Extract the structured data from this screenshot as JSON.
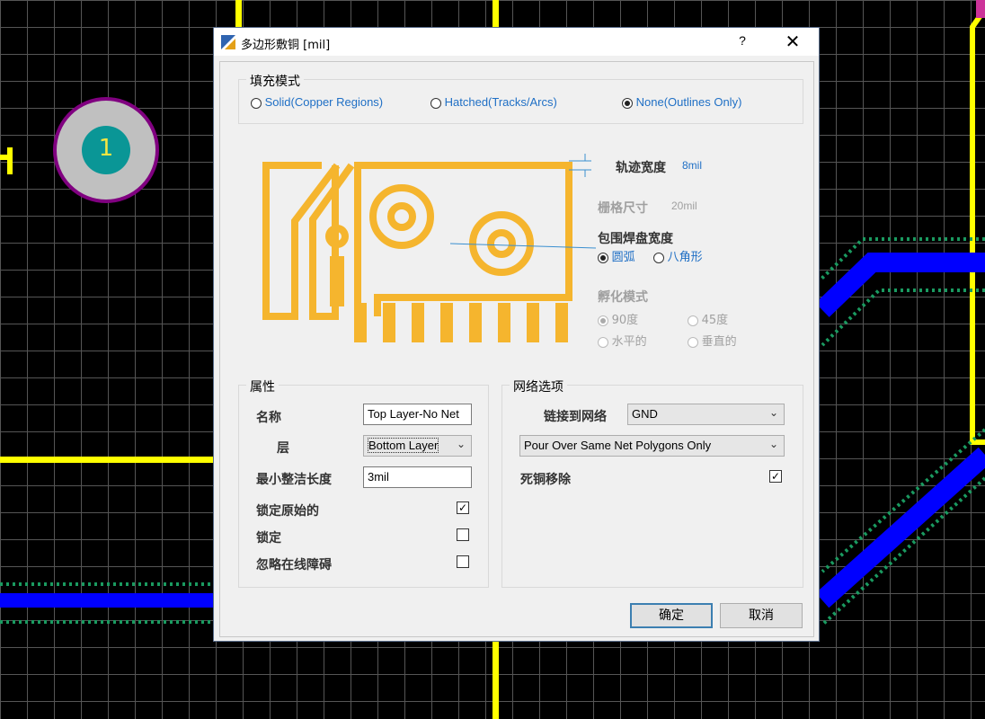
{
  "dialog": {
    "title": "多边形敷铜 [mil]",
    "help_label": "?",
    "close_label": "✕",
    "title_icon": "polygon-pour-icon"
  },
  "fill_mode": {
    "legend": "填充模式",
    "options": [
      {
        "label": "Solid(Copper Regions)",
        "selected": false
      },
      {
        "label": "Hatched(Tracks/Arcs)",
        "selected": false
      },
      {
        "label": "None(Outlines Only)",
        "selected": true
      }
    ]
  },
  "preview": {
    "track_width_label": "轨迹宽度",
    "track_width_value": "8mil",
    "grid_size_label": "栅格尺寸",
    "grid_size_value": "20mil",
    "surround_pads_label": "包围焊盘宽度",
    "surround_options": [
      {
        "label": "圆弧",
        "selected": true
      },
      {
        "label": "八角形",
        "selected": false
      }
    ],
    "hatch_mode_label": "孵化模式",
    "hatch_options": [
      {
        "label": "90度",
        "selected": true
      },
      {
        "label": "45度",
        "selected": false
      },
      {
        "label": "水平的",
        "selected": false
      },
      {
        "label": "垂直的",
        "selected": false
      }
    ],
    "pad_number": "1"
  },
  "properties": {
    "legend": "属性",
    "name_label": "名称",
    "name_value": "Top Layer-No Net",
    "layer_label": "层",
    "layer_value": "Bottom Layer",
    "min_prim_label": "最小整洁长度",
    "min_prim_value": "3mil",
    "lock_primitives_label": "锁定原始的",
    "lock_primitives_checked": true,
    "locked_label": "锁定",
    "locked_checked": false,
    "ignore_label": "忽略在线障碍",
    "ignore_checked": false
  },
  "net_options": {
    "legend": "网络选项",
    "connect_label": "链接到网络",
    "connect_value": "GND",
    "pour_value": "Pour Over Same Net Polygons Only",
    "remove_dead_label": "死铜移除",
    "remove_dead_checked": true
  },
  "buttons": {
    "ok": "确定",
    "cancel": "取消"
  },
  "colors": {
    "copper": "#f5b52e",
    "track_yellow": "#ffff00",
    "track_blue": "#0000ff",
    "pad_teal": "#0a9696",
    "pad_ring": "#c0c0c0",
    "link_blue": "#1f6fc5"
  }
}
